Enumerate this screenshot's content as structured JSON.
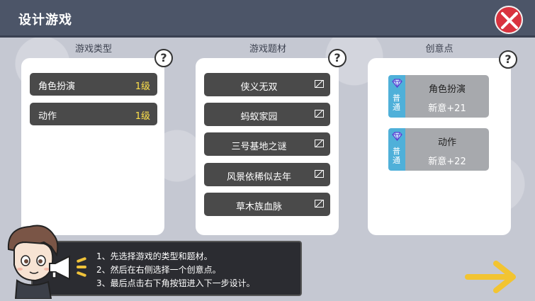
{
  "header": {
    "title": "设计游戏"
  },
  "columns": {
    "type": "游戏类型",
    "theme": "游戏题材",
    "idea": "创意点"
  },
  "help_label": "?",
  "game_types": [
    {
      "name": "角色扮演",
      "level": "1级"
    },
    {
      "name": "动作",
      "level": "1级"
    }
  ],
  "themes": [
    {
      "name": "侠义无双"
    },
    {
      "name": "蚂蚁家园"
    },
    {
      "name": "三号基地之谜"
    },
    {
      "name": "风景依稀似去年"
    },
    {
      "name": "草木族血脉"
    }
  ],
  "ideas": [
    {
      "tag": "普通",
      "name": "角色扮演",
      "bonus": "新意+21"
    },
    {
      "tag": "普通",
      "name": "动作",
      "bonus": "新意+22"
    }
  ],
  "tips": [
    "1、先选择游戏的类型和题材。",
    "2、然后在右侧选择一个创意点。",
    "3、最后点击右下角按钮进入下一步设计。"
  ],
  "colors": {
    "title_bar": "#4c5568",
    "close": "#d9333f",
    "level": "#ffe14a",
    "idea_tag": "#4fb0d9",
    "arrow": "#f2c431"
  },
  "icons": {
    "close": "close-x-icon",
    "help": "question-icon",
    "gem": "diamond-icon",
    "next": "next-arrow-icon",
    "speaker": "megaphone-icon"
  }
}
